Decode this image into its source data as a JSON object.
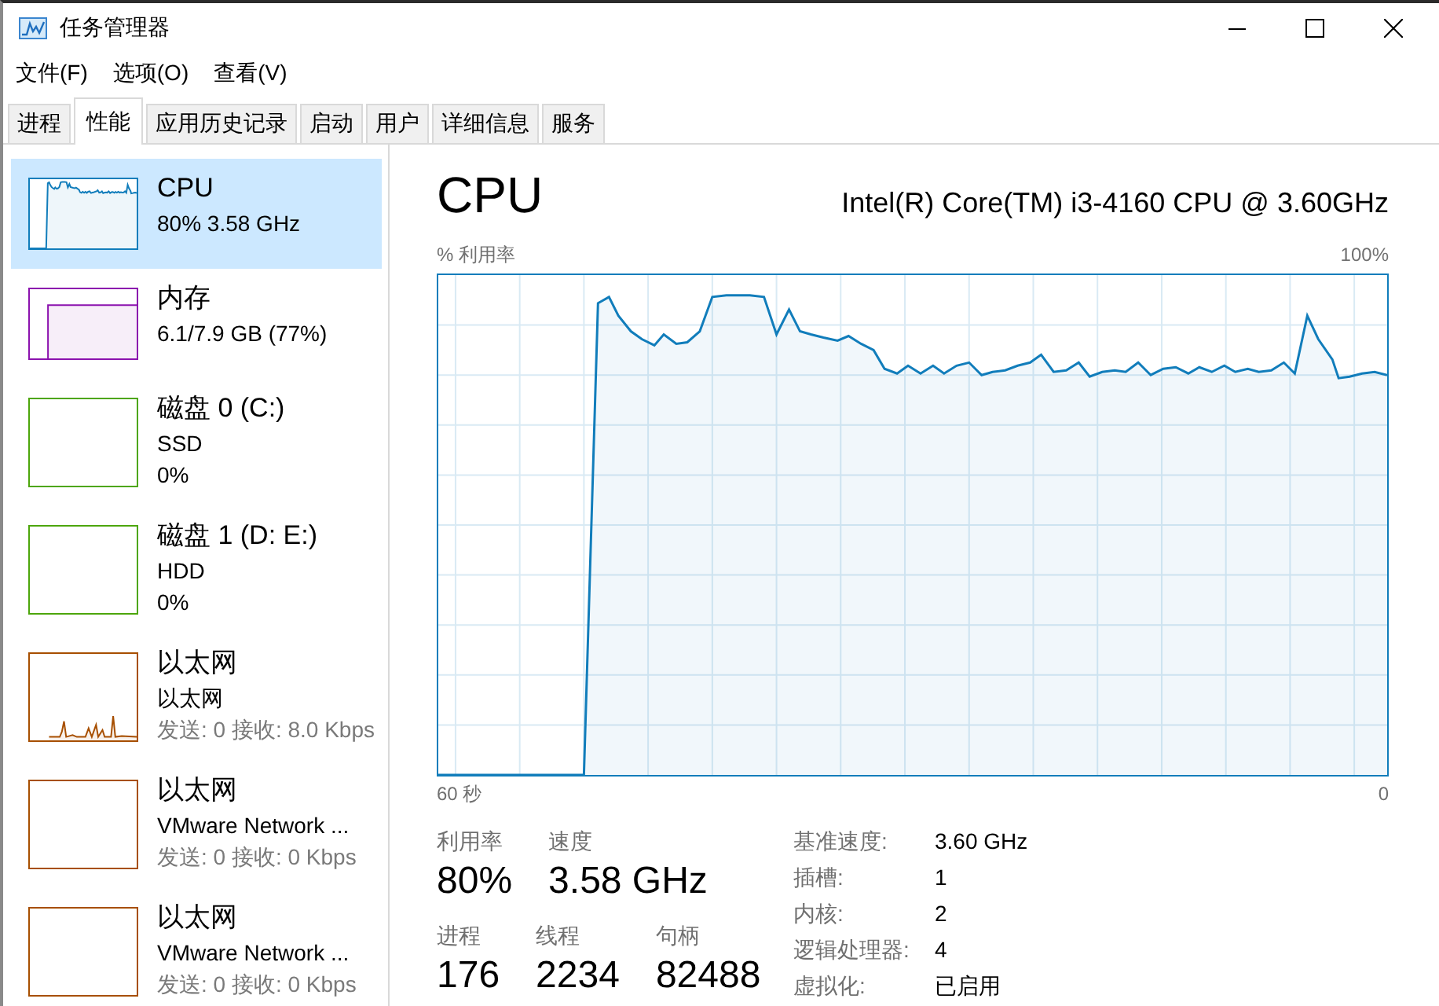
{
  "window": {
    "title": "任务管理器"
  },
  "menu": [
    {
      "label": "文件(F)"
    },
    {
      "label": "选项(O)"
    },
    {
      "label": "查看(V)"
    }
  ],
  "tabs": [
    {
      "label": "进程",
      "selected": false
    },
    {
      "label": "性能",
      "selected": true
    },
    {
      "label": "应用历史记录",
      "selected": false
    },
    {
      "label": "启动",
      "selected": false
    },
    {
      "label": "用户",
      "selected": false
    },
    {
      "label": "详细信息",
      "selected": false
    },
    {
      "label": "服务",
      "selected": false
    }
  ],
  "sidebar": {
    "items": [
      {
        "kind": "line",
        "title": "CPU",
        "lines": [
          "80% 3.58 GHz"
        ],
        "color": "#117dbb",
        "selected": true
      },
      {
        "kind": "block",
        "title": "内存",
        "lines": [
          "6.1/7.9 GB (77%)"
        ],
        "color": "#8b12ae",
        "selected": false
      },
      {
        "kind": "idle",
        "title": "磁盘 0 (C:)",
        "lines": [
          "SSD",
          "0%"
        ],
        "color": "#4da60c",
        "selected": false
      },
      {
        "kind": "idle",
        "title": "磁盘 1 (D: E:)",
        "lines": [
          "HDD",
          "0%"
        ],
        "color": "#4da60c",
        "selected": false
      },
      {
        "kind": "spikes",
        "title": "以太网",
        "lines": [
          "以太网"
        ],
        "traffic": "发送: 0 接收: 8.0 Kbps",
        "color": "#a74f01",
        "selected": false
      },
      {
        "kind": "idle",
        "title": "以太网",
        "lines": [
          "VMware Network ..."
        ],
        "traffic": "发送: 0 接收: 0 Kbps",
        "color": "#a74f01",
        "selected": false
      },
      {
        "kind": "idle",
        "title": "以太网",
        "lines": [
          "VMware Network ..."
        ],
        "traffic": "发送: 0 接收: 0 Kbps",
        "color": "#a74f01",
        "selected": false
      }
    ]
  },
  "detail": {
    "title": "CPU",
    "model": "Intel(R) Core(TM) i3-4160 CPU @ 3.60GHz",
    "graph": {
      "ylabel": "% 利用率",
      "ymax": "100%",
      "xstart": "60 秒",
      "xend": "0"
    },
    "stat_rows": [
      {
        "stats": [
          {
            "label": "利用率",
            "value": "80%"
          },
          {
            "label": "速度",
            "value": "3.58 GHz"
          }
        ]
      },
      {
        "stats": [
          {
            "label": "进程",
            "value": "176"
          },
          {
            "label": "线程",
            "value": "2234"
          },
          {
            "label": "句柄",
            "value": "82488"
          }
        ]
      }
    ],
    "properties": [
      {
        "label": "基准速度:",
        "value": "3.60 GHz"
      },
      {
        "label": "插槽:",
        "value": "1"
      },
      {
        "label": "内核:",
        "value": "2"
      },
      {
        "label": "逻辑处理器:",
        "value": "4"
      },
      {
        "label": "虚拟化:",
        "value": "已启用"
      }
    ]
  }
}
